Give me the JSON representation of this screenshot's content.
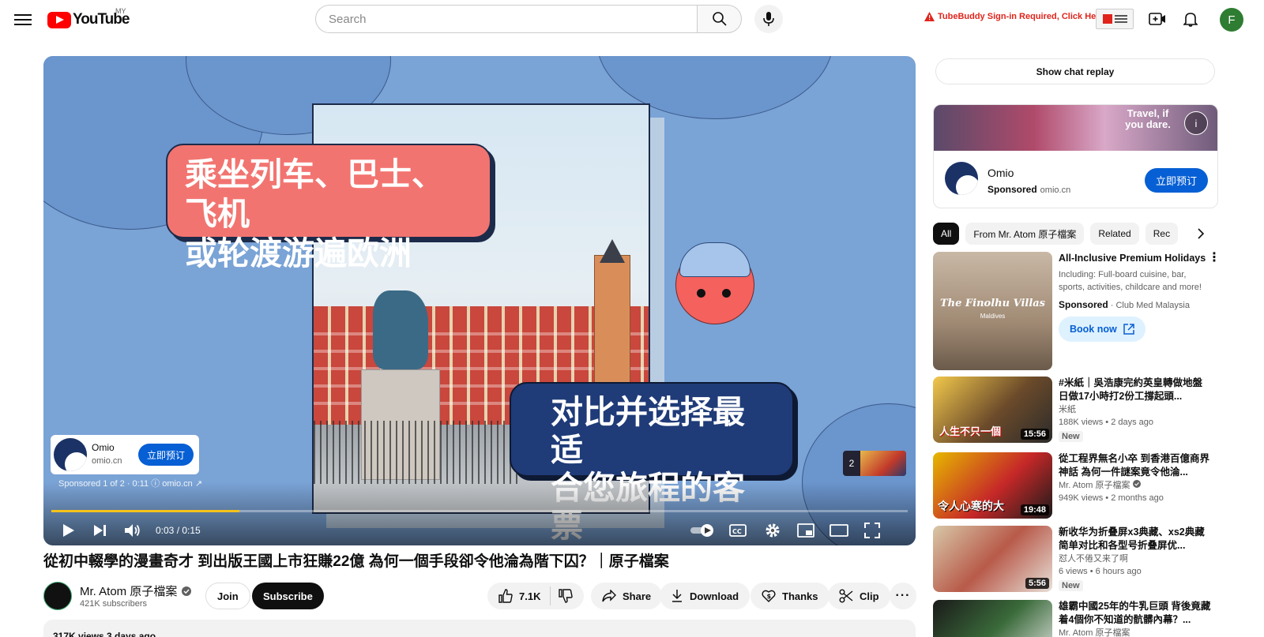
{
  "header": {
    "logo_text": "YouTube",
    "country": "MY",
    "search_placeholder": "Search",
    "tubebuddy_warning": "TubeBuddy Sign-in Required, Click Here",
    "avatar_letter": "F"
  },
  "player": {
    "bubble_top_line1": "乘坐列车、巴士、飞机",
    "bubble_top_line2": "或轮渡游遍欧洲",
    "bubble_bottom_line1": "对比并选择最适",
    "bubble_bottom_line2": "合您旅程的客票",
    "ad": {
      "name": "Omio",
      "url": "omio.cn",
      "cta": "立即预订",
      "meta": "Sponsored 1 of 2 · 0:11 ⓘ   omio.cn ↗"
    },
    "next_count": "2",
    "time": "0:03 / 0:15",
    "progress": 0.22
  },
  "video": {
    "title": "從初中輟學的漫畫奇才 到出版王國上市狂賺22億 為何一個手段卻令他淪為階下囚？｜原子檔案",
    "channel": "Mr. Atom 原子檔案",
    "subscribers": "421K subscribers",
    "join": "Join",
    "subscribe": "Subscribe",
    "likes": "7.1K",
    "share": "Share",
    "download": "Download",
    "thanks": "Thanks",
    "clip": "Clip",
    "views_line": "317K views  3 days ago"
  },
  "sidebar": {
    "chat_replay": "Show chat replay",
    "sponsor": {
      "banner_text": "Travel, if you dare.",
      "name": "Omio",
      "sponsored": "Sponsored",
      "domain": "omio.cn",
      "cta": "立即预订"
    },
    "chips": [
      "All",
      "From Mr. Atom 原子檔案",
      "Related",
      "Rec"
    ],
    "recs": [
      {
        "title": "All-Inclusive Premium Holidays",
        "desc": "Including: Full-board cuisine, bar, sports, activities, childcare and more!",
        "sponsored": "Sponsored",
        "advertiser": "Club Med Malaysia",
        "cta": "Book now",
        "thumb_text": "The Finolhu Villas",
        "thumb_sub": "Maldives"
      },
      {
        "title": "#米紙｜吳浩康完約英皇轉做地盤 日做17小時打2份工撐起頭...",
        "channel": "米紙",
        "meta": "188K views  • 2 days ago",
        "badge": "New",
        "duration": "15:56",
        "thumb_text": "人生不只一個"
      },
      {
        "title": "從工程界無名小卒 到香港百億商界神話 為何一件謎案竟令他淪...",
        "channel": "Mr. Atom 原子檔案",
        "meta": "949K views  • 2 months ago",
        "duration": "19:48",
        "thumb_text": "令人心寒的大"
      },
      {
        "title": "新收华为折叠屏x3典藏、xs2典藏简单对比和各型号折叠屏优...",
        "channel": "怼人不倦又来了啊",
        "meta": "6 views  • 6 hours ago",
        "badge": "New",
        "duration": "5:56"
      },
      {
        "title": "雄霸中國25年的牛乳巨頭 背後竟藏着4個你不知道的骯髒內幕？...",
        "channel": "Mr. Atom 原子檔案"
      }
    ]
  }
}
